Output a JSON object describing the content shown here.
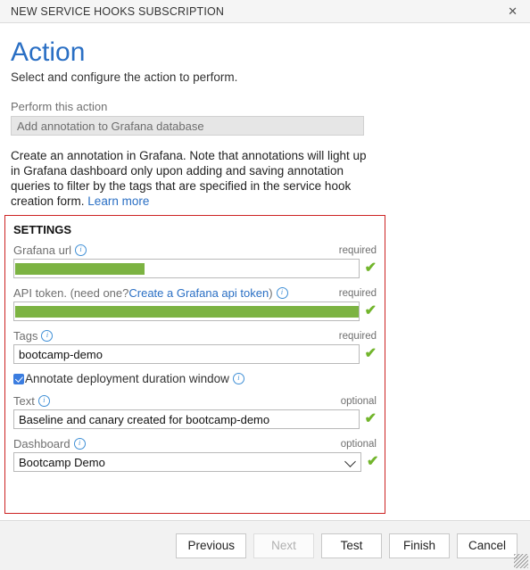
{
  "window": {
    "title": "NEW SERVICE HOOKS SUBSCRIPTION",
    "close_label": "✕"
  },
  "page": {
    "heading": "Action",
    "subheading": "Select and configure the action to perform.",
    "action_label": "Perform this action",
    "action_value": "Add annotation to Grafana database",
    "description": "Create an annotation in Grafana. Note that annotations will light up in Grafana dashboard only upon adding and saving annotation queries to filter by the tags that are specified in the service hook creation form.",
    "learn_more": "Learn more"
  },
  "settings": {
    "title": "SETTINGS",
    "accent_color": "#cc2222",
    "valid_mark": "✔",
    "fields": [
      {
        "label": "Grafana url",
        "info_icon": "info-icon",
        "requirement": "required",
        "value": "",
        "redacted": true,
        "valid": true
      },
      {
        "label": "API token. (need one? ",
        "link_text": "Create a Grafana api token",
        "label_suffix": ")",
        "info_icon": "info-icon",
        "requirement": "required",
        "value": "",
        "redacted": true,
        "valid": true
      },
      {
        "label": "Tags",
        "info_icon": "info-icon",
        "requirement": "required",
        "value": "bootcamp-demo",
        "redacted": false,
        "valid": true
      },
      {
        "label": "Text",
        "info_icon": "info-icon",
        "requirement": "optional",
        "value": "Baseline and canary created for bootcamp-demo",
        "redacted": false,
        "valid": true
      },
      {
        "label": "Dashboard",
        "info_icon": "info-icon",
        "requirement": "optional",
        "value": "Bootcamp Demo",
        "redacted": false,
        "valid": true
      }
    ],
    "checkbox": {
      "label": "Annotate deployment duration window",
      "checked": true,
      "info_icon": "info-icon"
    }
  },
  "footer": {
    "buttons": [
      {
        "label": "Previous",
        "disabled": false
      },
      {
        "label": "Next",
        "disabled": true
      },
      {
        "label": "Test",
        "disabled": false
      },
      {
        "label": "Finish",
        "disabled": false
      },
      {
        "label": "Cancel",
        "disabled": false
      }
    ]
  }
}
